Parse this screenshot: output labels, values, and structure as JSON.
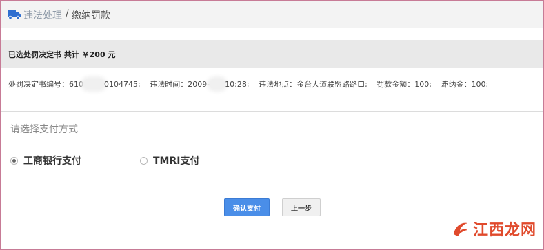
{
  "breadcrumb": {
    "parent": "违法处理",
    "separator": "/",
    "current": "缴纳罚款"
  },
  "summary": {
    "text": "已选处罚决定书 共计 ￥200 元"
  },
  "detail": {
    "decision_label": "处罚决定书编号：",
    "decision_prefix": "610",
    "decision_suffix": "0104745;",
    "time_label": "违法时间：",
    "time_prefix": "2009-",
    "time_suffix": "10:28;",
    "location_label": "违法地点：",
    "location_value": "金台大道联盟路路口;",
    "fine_label": "罚款金额：",
    "fine_value": "100;",
    "late_label": "滞纳金：",
    "late_value": "100;"
  },
  "payment": {
    "title": "请选择支付方式",
    "options": [
      {
        "label": "工商银行支付",
        "selected": true
      },
      {
        "label": "TMRI支付",
        "selected": false
      }
    ]
  },
  "buttons": {
    "confirm": "确认支付",
    "back": "上一步"
  },
  "watermark": {
    "text": "江西龙网"
  },
  "colors": {
    "accent": "#4a8ee8",
    "breadcrumb_link": "#8e9aa8",
    "watermark": "#e04a2c"
  }
}
